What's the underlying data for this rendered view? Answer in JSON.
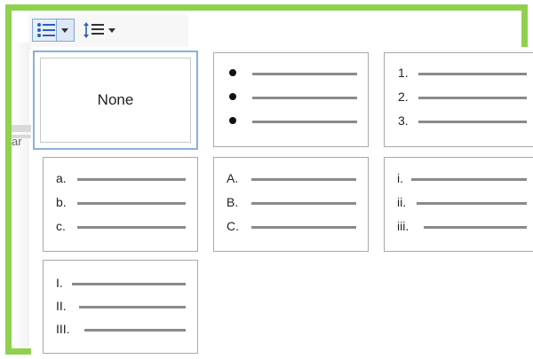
{
  "toolbar": {
    "bullet_list_icon": "bulleted-list-icon",
    "dropdown_icon": "chevron-down-icon",
    "spacing_icon": "line-spacing-icon"
  },
  "background": {
    "snippet_text": "ar"
  },
  "gallery": {
    "none_label": "None",
    "bullets": {
      "markers": [
        "",
        "",
        ""
      ]
    },
    "numbers": {
      "markers": [
        "1.",
        "2.",
        "3."
      ]
    },
    "lower_alpha": {
      "markers": [
        "a.",
        "b.",
        "c."
      ]
    },
    "upper_alpha": {
      "markers": [
        "A.",
        "B.",
        "C."
      ]
    },
    "lower_roman": {
      "markers": [
        "i.",
        "ii.",
        "iii."
      ]
    },
    "upper_roman": {
      "markers": [
        "I.",
        "II.",
        "III."
      ]
    }
  },
  "colors": {
    "frame": "#8fd14f",
    "selected_border": "#8ab0dc",
    "tile_border": "#a9a9a9"
  }
}
